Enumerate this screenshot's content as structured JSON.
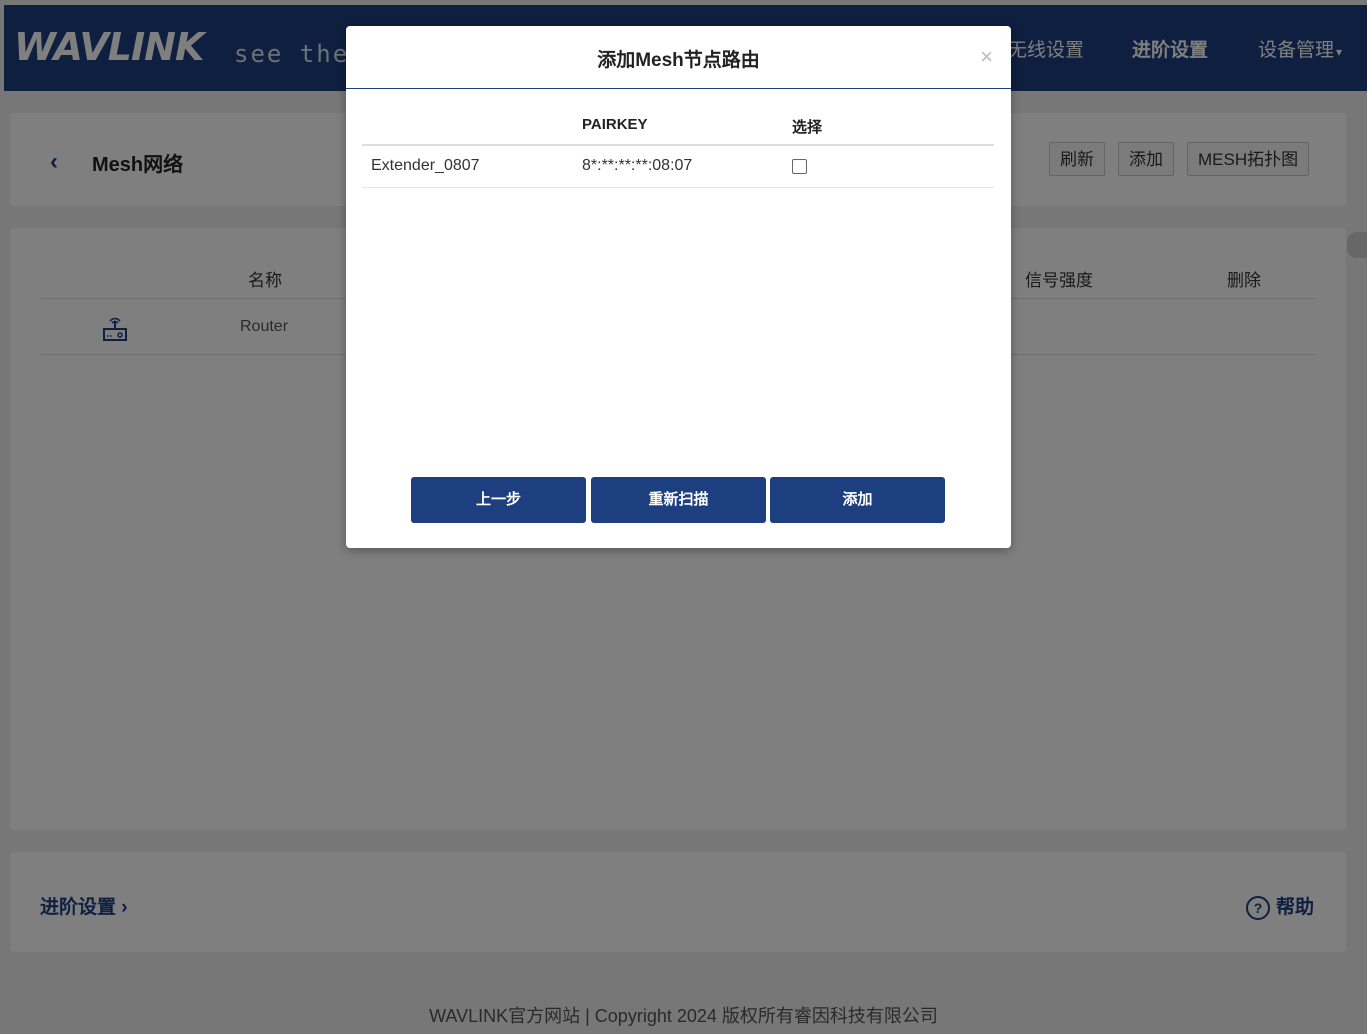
{
  "header": {
    "logo": "WAVLINK",
    "tagline": "see the w",
    "nav": [
      {
        "label": "无线设置",
        "active": false
      },
      {
        "label": "进阶设置",
        "active": true
      },
      {
        "label": "设备管理",
        "active": false,
        "caret": "▾"
      }
    ]
  },
  "mesh_card": {
    "back": "‹",
    "title": "Mesh网络",
    "buttons": {
      "refresh": "刷新",
      "add": "添加",
      "topology": "MESH拓扑图"
    }
  },
  "mesh_table": {
    "columns": {
      "name": "名称",
      "signal": "信号强度",
      "delete": "删除"
    },
    "rows": [
      {
        "name": "Router",
        "icon": "router-icon"
      }
    ]
  },
  "footer_card": {
    "advanced": "进阶设置",
    "advanced_arrow": "›",
    "help_icon": "?",
    "help": "帮助"
  },
  "copyright": "WAVLINK官方网站 | Copyright 2024 版权所有睿因科技有限公司",
  "modal": {
    "title": "添加Mesh节点路由",
    "close": "×",
    "columns": {
      "name": "",
      "pairkey": "PAIRKEY",
      "select": "选择"
    },
    "rows": [
      {
        "name": "Extender_0807",
        "pairkey": "8*:**:**:**:08:07",
        "selected": false
      }
    ],
    "buttons": {
      "prev": "上一步",
      "rescan": "重新扫描",
      "add": "添加"
    }
  },
  "colors": {
    "brand": "#1d3f80",
    "overlay": "rgba(0,0,0,0.5)"
  }
}
